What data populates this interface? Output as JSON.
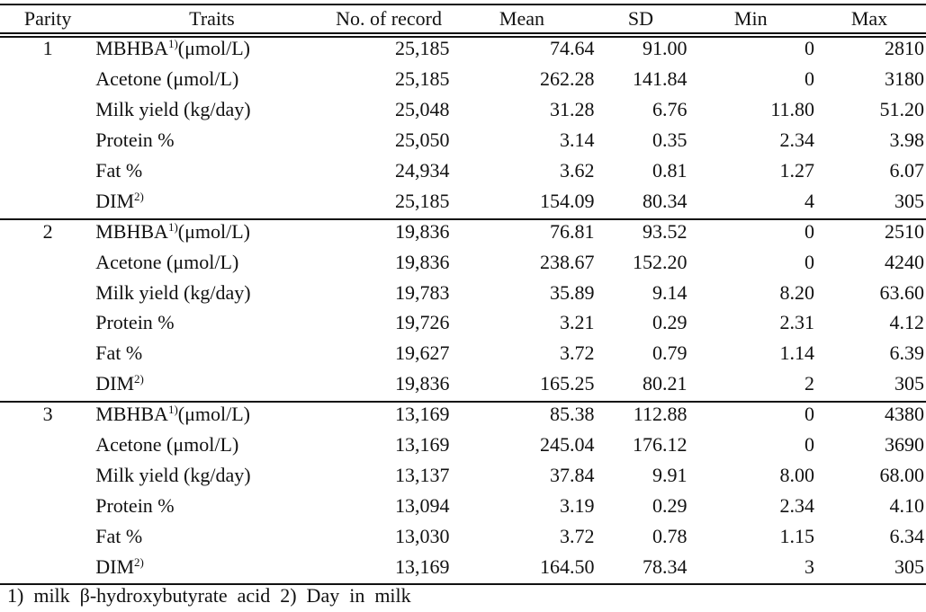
{
  "table": {
    "columns": [
      "Parity",
      "Traits",
      "No. of record",
      "Mean",
      "SD",
      "Min",
      "Max"
    ],
    "groups": [
      {
        "parity": "1",
        "rows": [
          {
            "trait": "MBHBA",
            "sup": "1)",
            "unit": "(μmol/L)",
            "n": "25,185",
            "mean": "74.64",
            "sd": "91.00",
            "min": "0",
            "max": "2810"
          },
          {
            "trait": "Acetone  (μmol/L)",
            "sup": "",
            "unit": "",
            "n": "25,185",
            "mean": "262.28",
            "sd": "141.84",
            "min": "0",
            "max": "3180"
          },
          {
            "trait": "Milk yield (kg/day)",
            "sup": "",
            "unit": "",
            "n": "25,048",
            "mean": "31.28",
            "sd": "6.76",
            "min": "11.80",
            "max": "51.20"
          },
          {
            "trait": "Protein  %",
            "sup": "",
            "unit": "",
            "n": "25,050",
            "mean": "3.14",
            "sd": "0.35",
            "min": "2.34",
            "max": "3.98"
          },
          {
            "trait": "Fat  %",
            "sup": "",
            "unit": "",
            "n": "24,934",
            "mean": "3.62",
            "sd": "0.81",
            "min": "1.27",
            "max": "6.07"
          },
          {
            "trait": "DIM",
            "sup": "2)",
            "unit": "",
            "n": "25,185",
            "mean": "154.09",
            "sd": "80.34",
            "min": "4",
            "max": "305"
          }
        ]
      },
      {
        "parity": "2",
        "rows": [
          {
            "trait": "MBHBA",
            "sup": "1)",
            "unit": "(μmol/L)",
            "n": "19,836",
            "mean": "76.81",
            "sd": "93.52",
            "min": "0",
            "max": "2510"
          },
          {
            "trait": "Acetone  (μmol/L)",
            "sup": "",
            "unit": "",
            "n": "19,836",
            "mean": "238.67",
            "sd": "152.20",
            "min": "0",
            "max": "4240"
          },
          {
            "trait": "Milk yield (kg/day)",
            "sup": "",
            "unit": "",
            "n": "19,783",
            "mean": "35.89",
            "sd": "9.14",
            "min": "8.20",
            "max": "63.60"
          },
          {
            "trait": "Protein  %",
            "sup": "",
            "unit": "",
            "n": "19,726",
            "mean": "3.21",
            "sd": "0.29",
            "min": "2.31",
            "max": "4.12"
          },
          {
            "trait": "Fat  %",
            "sup": "",
            "unit": "",
            "n": "19,627",
            "mean": "3.72",
            "sd": "0.79",
            "min": "1.14",
            "max": "6.39"
          },
          {
            "trait": "DIM",
            "sup": "2)",
            "unit": "",
            "n": "19,836",
            "mean": "165.25",
            "sd": "80.21",
            "min": "2",
            "max": "305"
          }
        ]
      },
      {
        "parity": "3",
        "rows": [
          {
            "trait": "MBHBA",
            "sup": "1)",
            "unit": "(μmol/L)",
            "n": "13,169",
            "mean": "85.38",
            "sd": "112.88",
            "min": "0",
            "max": "4380"
          },
          {
            "trait": "Acetone  (μmol/L)",
            "sup": "",
            "unit": "",
            "n": "13,169",
            "mean": "245.04",
            "sd": "176.12",
            "min": "0",
            "max": "3690"
          },
          {
            "trait": "Milk yield (kg/day)",
            "sup": "",
            "unit": "",
            "n": "13,137",
            "mean": "37.84",
            "sd": "9.91",
            "min": "8.00",
            "max": "68.00"
          },
          {
            "trait": "Protein  %",
            "sup": "",
            "unit": "",
            "n": "13,094",
            "mean": "3.19",
            "sd": "0.29",
            "min": "2.34",
            "max": "4.10"
          },
          {
            "trait": "Fat  %",
            "sup": "",
            "unit": "",
            "n": "13,030",
            "mean": "3.72",
            "sd": "0.78",
            "min": "1.15",
            "max": "6.34"
          },
          {
            "trait": "DIM",
            "sup": "2)",
            "unit": "",
            "n": "13,169",
            "mean": "164.50",
            "sd": "78.34",
            "min": "3",
            "max": "305"
          }
        ]
      }
    ]
  },
  "footnote": "1)  milk  β-hydroxybutyrate  acid  2)  Day  in  milk"
}
